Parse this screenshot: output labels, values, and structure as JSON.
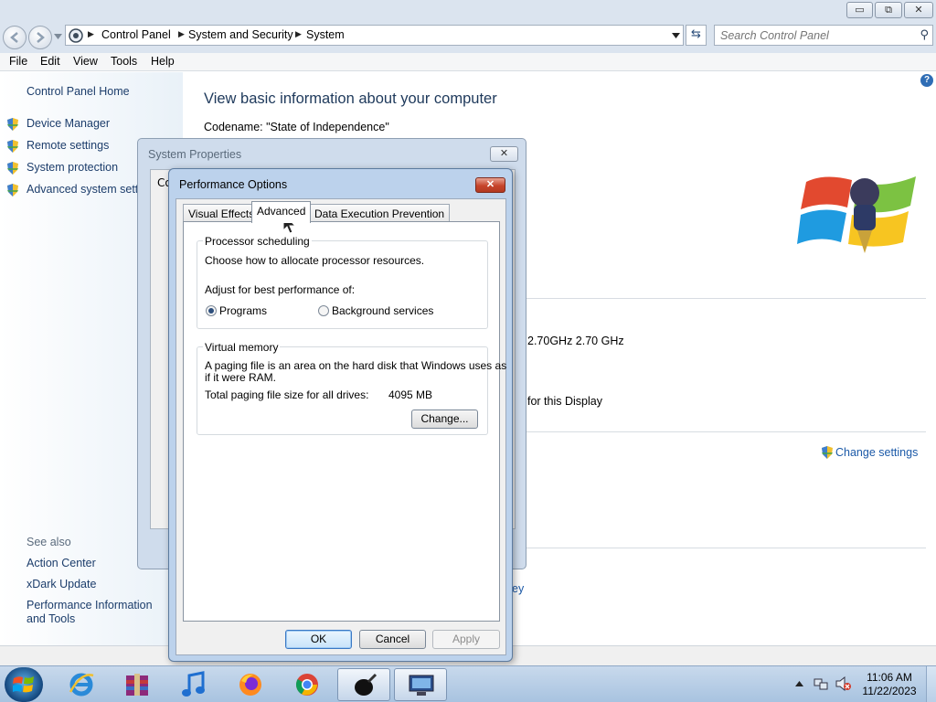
{
  "window": {
    "minimize_glyph": "▭",
    "maximize_glyph": "⧉",
    "close_glyph": "✕"
  },
  "address": {
    "crumbs": [
      "Control Panel",
      "System and Security",
      "System"
    ],
    "search_placeholder": "Search Control Panel"
  },
  "menu": [
    "File",
    "Edit",
    "View",
    "Tools",
    "Help"
  ],
  "sidebar": {
    "home": "Control Panel Home",
    "items": [
      {
        "label": "Device Manager"
      },
      {
        "label": "Remote settings"
      },
      {
        "label": "System protection"
      },
      {
        "label": "Advanced system settings"
      }
    ],
    "see_also_title": "See also",
    "see_also": [
      "Action Center",
      "xDark Update",
      "Performance Information and Tools"
    ]
  },
  "main": {
    "heading": "View basic information about your computer",
    "codename": "Codename: \"State of Independence\"",
    "processor_speed": "2.70GHz   2.70 GHz",
    "display_note": "for this Display",
    "change_settings": "Change settings",
    "partial_link": "ey"
  },
  "system_properties": {
    "title": "System Properties",
    "partial_tab": "Co"
  },
  "performance_options": {
    "title": "Performance Options",
    "tabs": [
      "Visual Effects",
      "Advanced",
      "Data Execution Prevention"
    ],
    "active_tab": "Advanced",
    "processor": {
      "group_title": "Processor scheduling",
      "description": "Choose how to allocate processor resources.",
      "adjust_label": "Adjust for best performance of:",
      "options": [
        {
          "label": "Programs",
          "checked": true
        },
        {
          "label": "Background services",
          "checked": false
        }
      ]
    },
    "virtual_memory": {
      "group_title": "Virtual memory",
      "description_line1": "A paging file is an area on the hard disk that Windows uses as",
      "description_line2": "if it were RAM.",
      "total_label": "Total paging file size for all drives:",
      "total_value": "4095 MB",
      "change_button": "Change..."
    },
    "buttons": {
      "ok": "OK",
      "cancel": "Cancel",
      "apply": "Apply"
    }
  },
  "taskbar": {
    "icons": [
      "windows-start-icon",
      "internet-explorer-icon",
      "archive-icon",
      "music-icon",
      "firefox-icon",
      "chrome-icon",
      "paint-icon",
      "system-icon"
    ],
    "clock_time": "11:06 AM",
    "clock_date": "11/22/2023"
  }
}
